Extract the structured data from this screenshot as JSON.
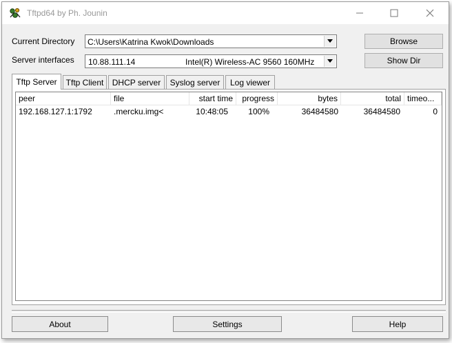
{
  "window": {
    "title": "Tftpd64 by Ph. Jounin",
    "icons": [
      "tftpd-app-icon",
      "minimize-icon",
      "maximize-icon",
      "close-icon"
    ]
  },
  "form": {
    "current_directory_label": "Current Directory",
    "current_directory_value": "C:\\Users\\Katrina Kwok\\Downloads",
    "server_interfaces_label": "Server interfaces",
    "server_interface_ip": "10.88.111.14",
    "server_interface_name": "Intel(R) Wireless-AC 9560 160MHz",
    "browse_label": "Browse",
    "show_dir_label": "Show Dir"
  },
  "tabs": [
    {
      "label": "Tftp Server",
      "active": true
    },
    {
      "label": "Tftp Client",
      "active": false
    },
    {
      "label": "DHCP server",
      "active": false
    },
    {
      "label": "Syslog server",
      "active": false
    },
    {
      "label": "Log viewer",
      "active": false
    }
  ],
  "table": {
    "columns": [
      "peer",
      "file",
      "start time",
      "progress",
      "bytes",
      "total",
      "timeo..."
    ],
    "rows": [
      [
        "192.168.127.1:1792",
        ".mercku.img<",
        "10:48:05",
        "100%",
        "36484580",
        "36484580",
        "0"
      ]
    ]
  },
  "footer": {
    "about_label": "About",
    "settings_label": "Settings",
    "help_label": "Help"
  }
}
